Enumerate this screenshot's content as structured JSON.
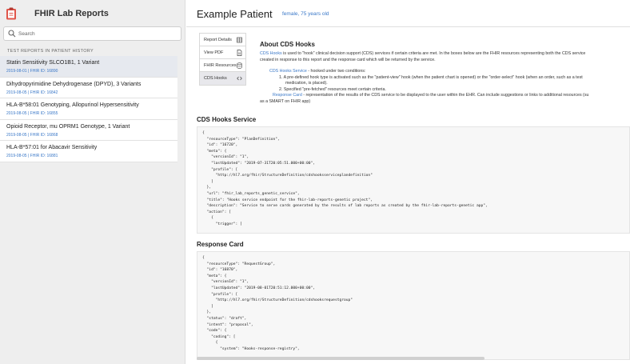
{
  "app": {
    "title": "FHIR Lab Reports"
  },
  "search": {
    "placeholder": "Search",
    "value": ""
  },
  "sidebar": {
    "section_header": "TEST REPORTS IN PATIENT HISTORY",
    "reports": [
      {
        "name": "Statin Sensitivity SLCO1B1, 1 Variant",
        "meta": "2019-08-01 | FHIR ID: 16890",
        "selected": true
      },
      {
        "name": "Dihydropyrimidine Dehydrogenase (DPYD), 3 Variants",
        "meta": "2019-08-05 | FHIR ID: 16842",
        "selected": false
      },
      {
        "name": "HLA-B*58:01 Genotyping, Allopurinol Hypersensitivity",
        "meta": "2019-08-05 | FHIR ID: 16855",
        "selected": false
      },
      {
        "name": "Opioid Receptor, mu OPRM1 Genotype, 1 Variant",
        "meta": "2019-08-05 | FHIR ID: 16868",
        "selected": false
      },
      {
        "name": "HLA-B*57:01 for Abacavir Sensitivity",
        "meta": "2019-08-05 | FHIR ID: 16881",
        "selected": false
      }
    ]
  },
  "patient": {
    "name": "Example Patient",
    "info": "female, 75 years old"
  },
  "tabs": [
    {
      "label": "Report Details",
      "icon": "table-icon",
      "active": false
    },
    {
      "label": "View PDF",
      "icon": "document-icon",
      "active": false
    },
    {
      "label": "FHIR Resources",
      "icon": "database-icon",
      "active": false
    },
    {
      "label": "CDS Hooks",
      "icon": "code-icon",
      "active": true
    }
  ],
  "cds": {
    "title": "About CDS Hooks",
    "desc_link": "CDS Hooks",
    "desc_line1_rest": " is used to \"hook\" clinical decision support (CDS) services if certain criteria are met. In the boxes below are the FHIR resources representing both the CDS service",
    "desc_line2": "created in response to this report and the response card which will be returned by the service.",
    "service_link": "CDS Hooks Service",
    "service_rest": " - hooked under two conditions:",
    "cond1_line1": "1. A pre-defined hook type is activated such as the \"patient-view\" hook (when the patient chart is opened) or the \"order-select\" hook (when an order, such as a test",
    "cond1_line2": "medication, is placed).",
    "cond2": "2. Specified \"pre-fetched\" resources meet certain criteria.",
    "response_link": "Response Card",
    "response_rest": " - representation of the results of the CDS service to be displayed to the user within the EHR. Can include suggestions or links to additional resources (su",
    "response_line2": "as a SMART on FHIR app)"
  },
  "service_section": {
    "title": "CDS Hooks Service",
    "code": "{\n  \"resourceType\": \"PlanDefinition\",\n  \"id\": \"16720\",\n  \"meta\": {\n    \"versionId\": \"1\",\n    \"lastUpdated\": \"2019-07-31T20:05:51.000+00:00\",\n    \"profile\": [\n      \"http://hl7.org/fhir/StructureDefinition/cdshooksserviceplandefinition\"\n    ]\n  },\n  \"url\": \"fhir_lab_reports_genetic_service\",\n  \"title\": \"Hooks service endpoint for the fhir-lab-reports-genetic project\",\n  \"description\": \"Service to serve cards generated by the results of lab reports as created by the fhir-lab-reports-genetic app\",\n  \"action\": [\n    {\n      \"trigger\": ["
  },
  "response_section": {
    "title": "Response Card",
    "code": "{\n  \"resourceType\": \"RequestGroup\",\n  \"id\": \"16870\",\n  \"meta\": {\n    \"versionId\": \"1\",\n    \"lastUpdated\": \"2019-08-01T20:51:12.000+00:00\",\n    \"profile\": [\n      \"http://hl7.org/fhir/StructureDefinition/cdshooksrequestgroup\"\n    ]\n  },\n  \"status\": \"draft\",\n  \"intent\": \"proposal\",\n  \"code\": {\n    \"coding\": [\n      {\n        \"system\": \"Hooks-response-registry\","
  },
  "colors": {
    "accent": "#3a78c8",
    "sidebar_bg": "#eeeeee",
    "selected_bg": "#e6e9ef"
  }
}
